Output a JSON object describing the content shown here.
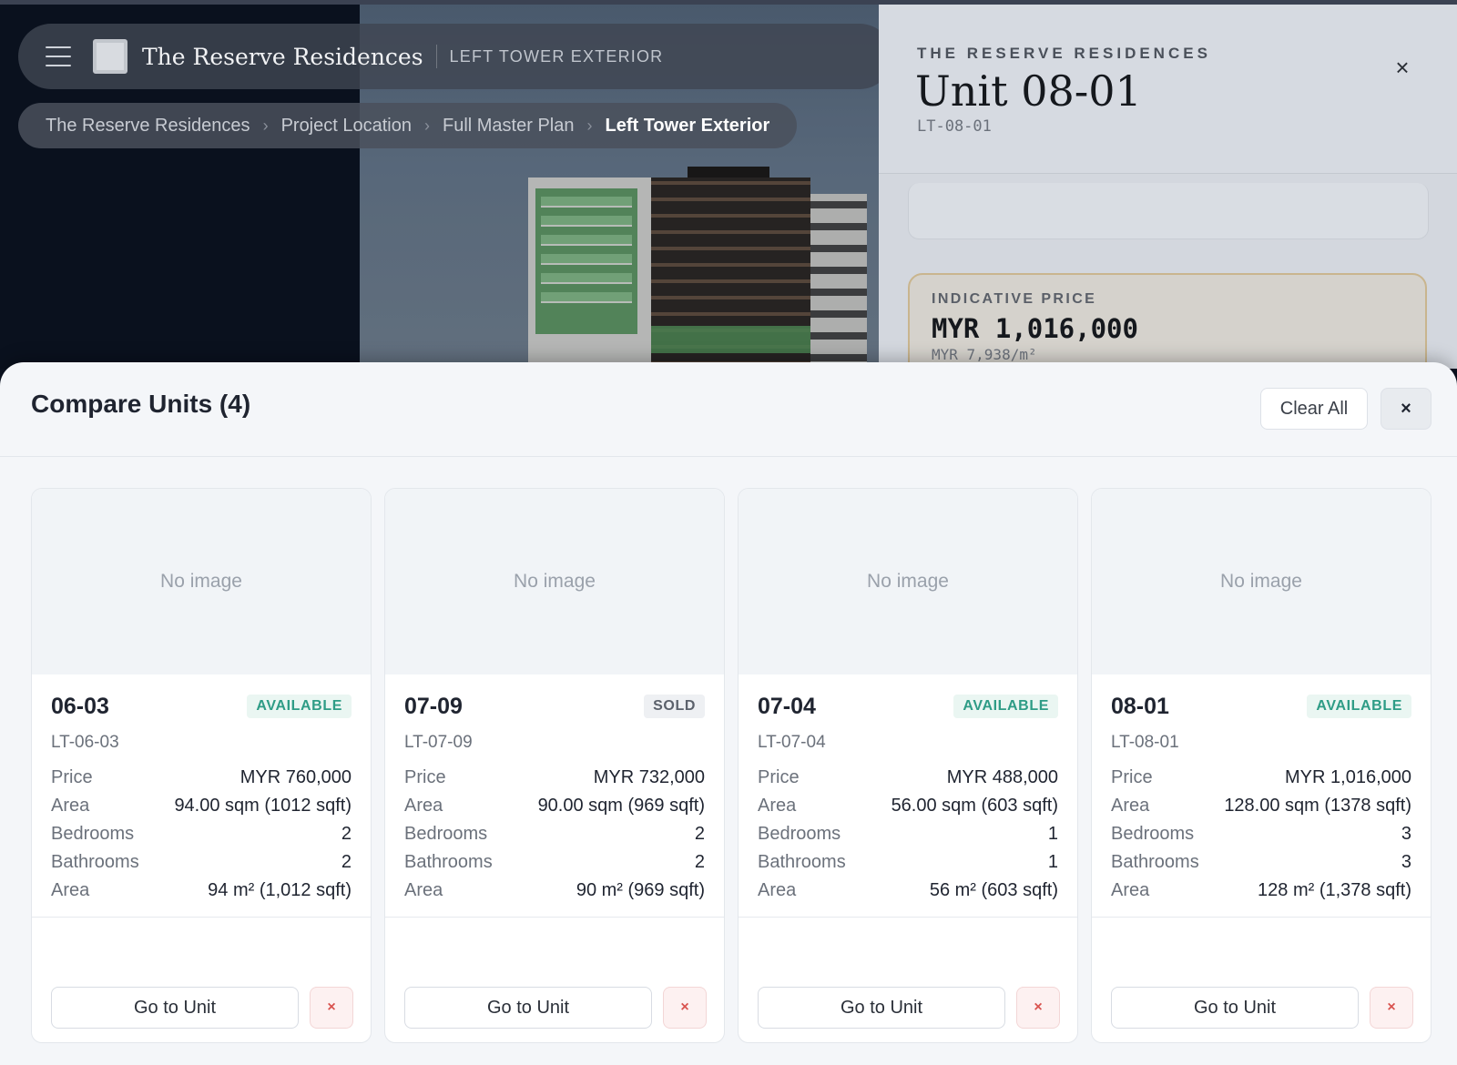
{
  "app": {
    "brand": "The Reserve Residences",
    "section": "LEFT TOWER EXTERIOR"
  },
  "breadcrumb": [
    "The Reserve Residences",
    "Project Location",
    "Full Master Plan",
    "Left Tower Exterior"
  ],
  "detail_panel": {
    "kicker": "THE RESERVE RESIDENCES",
    "title": "Unit 08-01",
    "code": "LT-08-01",
    "close_icon": "×",
    "price_label": "INDICATIVE PRICE",
    "price_value": "MYR 1,016,000",
    "price_per_sqm": "MYR 7,938/m²"
  },
  "compare": {
    "title": "Compare Units (4)",
    "clear_all": "Clear All",
    "close_icon": "×",
    "no_image": "No image",
    "go_to_unit": "Go to Unit",
    "remove_icon": "×",
    "labels": {
      "price": "Price",
      "area": "Area",
      "bedrooms": "Bedrooms",
      "bathrooms": "Bathrooms",
      "area2": "Area"
    },
    "units": [
      {
        "unit": "06-03",
        "status": "AVAILABLE",
        "code": "LT-06-03",
        "price": "MYR 760,000",
        "area": "94.00 sqm (1012 sqft)",
        "bedrooms": "2",
        "bathrooms": "2",
        "area2": "94 m² (1,012 sqft)"
      },
      {
        "unit": "07-09",
        "status": "SOLD",
        "code": "LT-07-09",
        "price": "MYR 732,000",
        "area": "90.00 sqm (969 sqft)",
        "bedrooms": "2",
        "bathrooms": "2",
        "area2": "90 m² (969 sqft)"
      },
      {
        "unit": "07-04",
        "status": "AVAILABLE",
        "code": "LT-07-04",
        "price": "MYR 488,000",
        "area": "56.00 sqm (603 sqft)",
        "bedrooms": "1",
        "bathrooms": "1",
        "area2": "56 m² (603 sqft)"
      },
      {
        "unit": "08-01",
        "status": "AVAILABLE",
        "code": "LT-08-01",
        "price": "MYR 1,016,000",
        "area": "128.00 sqm (1378 sqft)",
        "bedrooms": "3",
        "bathrooms": "3",
        "area2": "128 m² (1,378 sqft)"
      }
    ]
  },
  "colors": {
    "available": "#2e9c86",
    "sold": "#5b616b",
    "remove": "#d9534f"
  }
}
